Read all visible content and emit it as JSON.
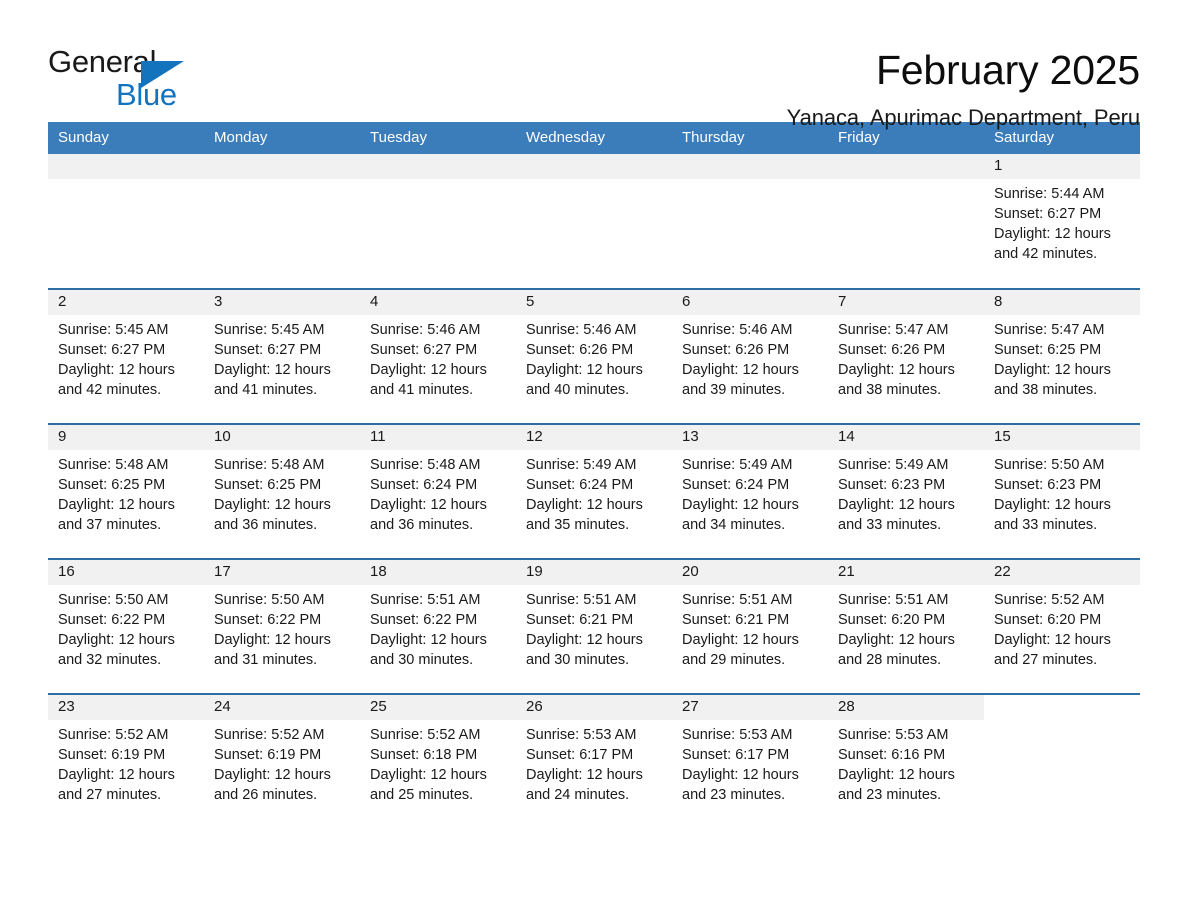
{
  "logo": {
    "word1": "General",
    "word2": "Blue",
    "triangle_color": "#1473bd"
  },
  "header": {
    "title": "February 2025",
    "subtitle": "Yanaca, Apurimac Department, Peru"
  },
  "theme": {
    "header_blue": "#3b7cbb",
    "divider_blue": "#2e6da4",
    "daynum_band": "#f1f1f1",
    "text": "#1a1a1a"
  },
  "weekday_headers": [
    "Sunday",
    "Monday",
    "Tuesday",
    "Wednesday",
    "Thursday",
    "Friday",
    "Saturday"
  ],
  "weeks": [
    [
      {
        "day": "",
        "lines": []
      },
      {
        "day": "",
        "lines": []
      },
      {
        "day": "",
        "lines": []
      },
      {
        "day": "",
        "lines": []
      },
      {
        "day": "",
        "lines": []
      },
      {
        "day": "",
        "lines": []
      },
      {
        "day": "1",
        "lines": [
          "Sunrise: 5:44 AM",
          "Sunset: 6:27 PM",
          "Daylight: 12 hours",
          "and 42 minutes."
        ]
      }
    ],
    [
      {
        "day": "2",
        "lines": [
          "Sunrise: 5:45 AM",
          "Sunset: 6:27 PM",
          "Daylight: 12 hours",
          "and 42 minutes."
        ]
      },
      {
        "day": "3",
        "lines": [
          "Sunrise: 5:45 AM",
          "Sunset: 6:27 PM",
          "Daylight: 12 hours",
          "and 41 minutes."
        ]
      },
      {
        "day": "4",
        "lines": [
          "Sunrise: 5:46 AM",
          "Sunset: 6:27 PM",
          "Daylight: 12 hours",
          "and 41 minutes."
        ]
      },
      {
        "day": "5",
        "lines": [
          "Sunrise: 5:46 AM",
          "Sunset: 6:26 PM",
          "Daylight: 12 hours",
          "and 40 minutes."
        ]
      },
      {
        "day": "6",
        "lines": [
          "Sunrise: 5:46 AM",
          "Sunset: 6:26 PM",
          "Daylight: 12 hours",
          "and 39 minutes."
        ]
      },
      {
        "day": "7",
        "lines": [
          "Sunrise: 5:47 AM",
          "Sunset: 6:26 PM",
          "Daylight: 12 hours",
          "and 38 minutes."
        ]
      },
      {
        "day": "8",
        "lines": [
          "Sunrise: 5:47 AM",
          "Sunset: 6:25 PM",
          "Daylight: 12 hours",
          "and 38 minutes."
        ]
      }
    ],
    [
      {
        "day": "9",
        "lines": [
          "Sunrise: 5:48 AM",
          "Sunset: 6:25 PM",
          "Daylight: 12 hours",
          "and 37 minutes."
        ]
      },
      {
        "day": "10",
        "lines": [
          "Sunrise: 5:48 AM",
          "Sunset: 6:25 PM",
          "Daylight: 12 hours",
          "and 36 minutes."
        ]
      },
      {
        "day": "11",
        "lines": [
          "Sunrise: 5:48 AM",
          "Sunset: 6:24 PM",
          "Daylight: 12 hours",
          "and 36 minutes."
        ]
      },
      {
        "day": "12",
        "lines": [
          "Sunrise: 5:49 AM",
          "Sunset: 6:24 PM",
          "Daylight: 12 hours",
          "and 35 minutes."
        ]
      },
      {
        "day": "13",
        "lines": [
          "Sunrise: 5:49 AM",
          "Sunset: 6:24 PM",
          "Daylight: 12 hours",
          "and 34 minutes."
        ]
      },
      {
        "day": "14",
        "lines": [
          "Sunrise: 5:49 AM",
          "Sunset: 6:23 PM",
          "Daylight: 12 hours",
          "and 33 minutes."
        ]
      },
      {
        "day": "15",
        "lines": [
          "Sunrise: 5:50 AM",
          "Sunset: 6:23 PM",
          "Daylight: 12 hours",
          "and 33 minutes."
        ]
      }
    ],
    [
      {
        "day": "16",
        "lines": [
          "Sunrise: 5:50 AM",
          "Sunset: 6:22 PM",
          "Daylight: 12 hours",
          "and 32 minutes."
        ]
      },
      {
        "day": "17",
        "lines": [
          "Sunrise: 5:50 AM",
          "Sunset: 6:22 PM",
          "Daylight: 12 hours",
          "and 31 minutes."
        ]
      },
      {
        "day": "18",
        "lines": [
          "Sunrise: 5:51 AM",
          "Sunset: 6:22 PM",
          "Daylight: 12 hours",
          "and 30 minutes."
        ]
      },
      {
        "day": "19",
        "lines": [
          "Sunrise: 5:51 AM",
          "Sunset: 6:21 PM",
          "Daylight: 12 hours",
          "and 30 minutes."
        ]
      },
      {
        "day": "20",
        "lines": [
          "Sunrise: 5:51 AM",
          "Sunset: 6:21 PM",
          "Daylight: 12 hours",
          "and 29 minutes."
        ]
      },
      {
        "day": "21",
        "lines": [
          "Sunrise: 5:51 AM",
          "Sunset: 6:20 PM",
          "Daylight: 12 hours",
          "and 28 minutes."
        ]
      },
      {
        "day": "22",
        "lines": [
          "Sunrise: 5:52 AM",
          "Sunset: 6:20 PM",
          "Daylight: 12 hours",
          "and 27 minutes."
        ]
      }
    ],
    [
      {
        "day": "23",
        "lines": [
          "Sunrise: 5:52 AM",
          "Sunset: 6:19 PM",
          "Daylight: 12 hours",
          "and 27 minutes."
        ]
      },
      {
        "day": "24",
        "lines": [
          "Sunrise: 5:52 AM",
          "Sunset: 6:19 PM",
          "Daylight: 12 hours",
          "and 26 minutes."
        ]
      },
      {
        "day": "25",
        "lines": [
          "Sunrise: 5:52 AM",
          "Sunset: 6:18 PM",
          "Daylight: 12 hours",
          "and 25 minutes."
        ]
      },
      {
        "day": "26",
        "lines": [
          "Sunrise: 5:53 AM",
          "Sunset: 6:17 PM",
          "Daylight: 12 hours",
          "and 24 minutes."
        ]
      },
      {
        "day": "27",
        "lines": [
          "Sunrise: 5:53 AM",
          "Sunset: 6:17 PM",
          "Daylight: 12 hours",
          "and 23 minutes."
        ]
      },
      {
        "day": "28",
        "lines": [
          "Sunrise: 5:53 AM",
          "Sunset: 6:16 PM",
          "Daylight: 12 hours",
          "and 23 minutes."
        ]
      },
      {
        "day": "",
        "lines": [],
        "blank": true
      }
    ]
  ]
}
